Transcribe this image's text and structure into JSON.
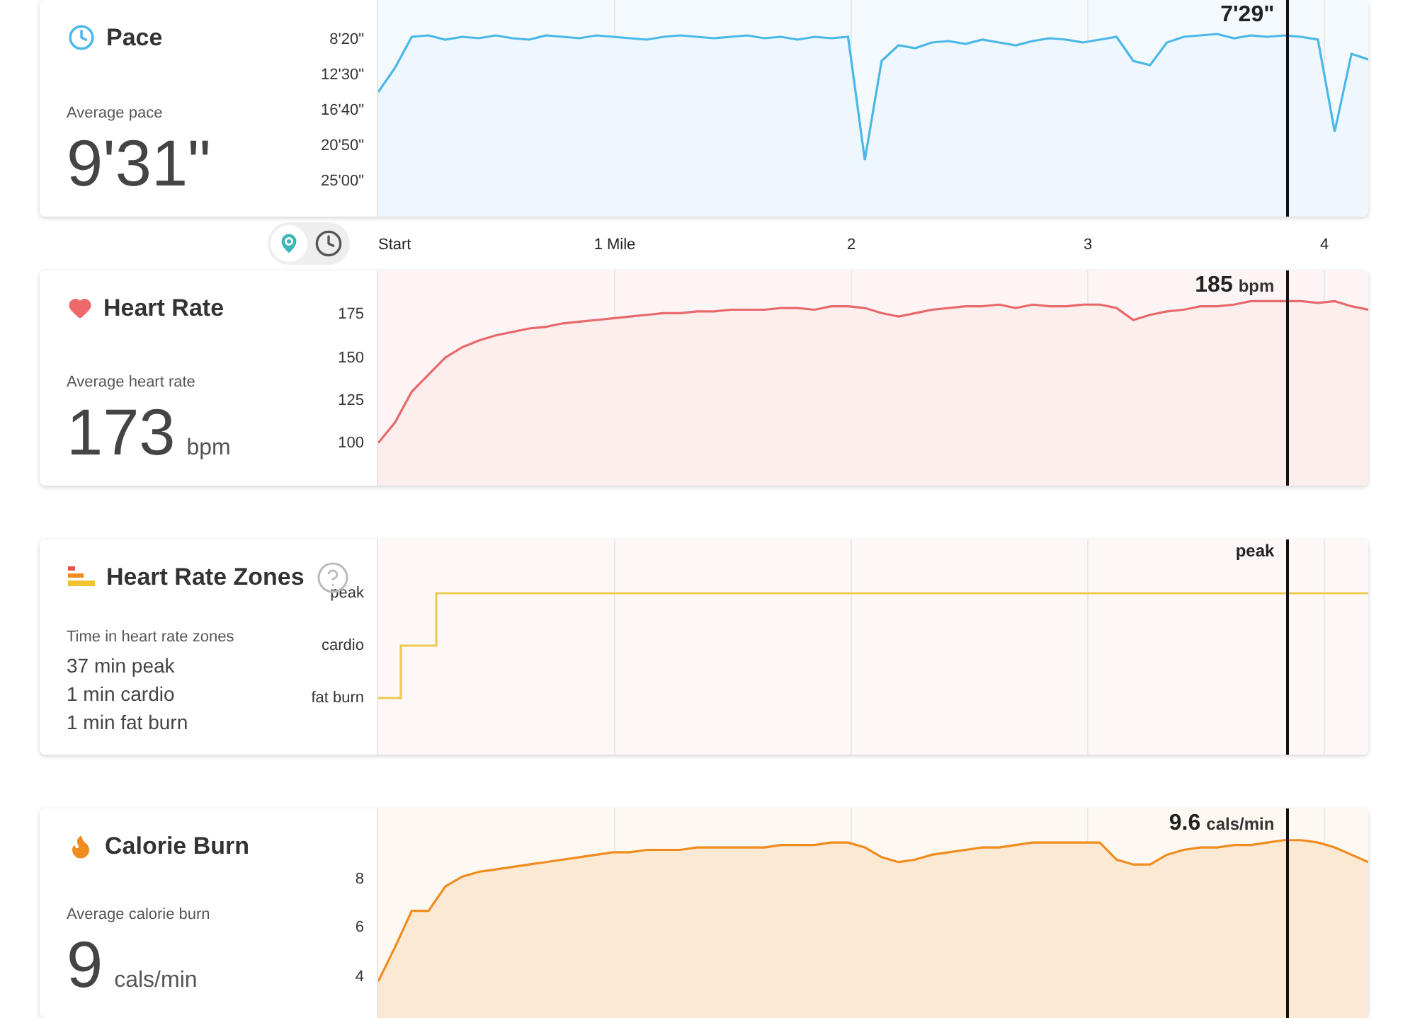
{
  "scrubber": {
    "level": 0.918
  },
  "distance_axis": {
    "labels": [
      "Start",
      "1 Mile",
      "2",
      "3",
      "4"
    ],
    "view_toggle": [
      {
        "kind": "map",
        "selected": true
      },
      {
        "kind": "time",
        "selected": false
      }
    ]
  },
  "cards": [
    {
      "kind": "pace",
      "title": "Pace",
      "help": false,
      "subtitle": "Average pace",
      "value": "9'31\"",
      "readout": {
        "value": "7'29\""
      },
      "y_axis_labels": [
        "8'20\"",
        "12'30\"",
        "16'40\"",
        "20'50\"",
        "25'00\""
      ]
    },
    {
      "kind": "heart",
      "title": "Heart Rate",
      "help": false,
      "subtitle": "Average heart rate",
      "value": "173",
      "unit": "bpm",
      "readout": {
        "value": "185",
        "unit": "bpm"
      },
      "chart_data": {
        "type": "area",
        "ylim": [
          75,
          201
        ],
        "yticks": [
          {
            "value": 175,
            "label": "175"
          },
          {
            "value": 150,
            "label": "150"
          },
          {
            "value": 125,
            "label": "125"
          },
          {
            "value": 100,
            "label": "100"
          }
        ],
        "series": [
          {
            "color": "#e8696b",
            "values": [
              100,
              112,
              130,
              140,
              150,
              156,
              160,
              163,
              165,
              167,
              168,
              170,
              171,
              172,
              173,
              174,
              175,
              176,
              176,
              177,
              177,
              178,
              178,
              178,
              179,
              179,
              178,
              180,
              180,
              179,
              176,
              174,
              176,
              178,
              179,
              180,
              180,
              181,
              179,
              181,
              180,
              180,
              181,
              181,
              179,
              172,
              175,
              177,
              178,
              180,
              180,
              181,
              183,
              183,
              183,
              183,
              182,
              183,
              180,
              178
            ]
          }
        ]
      }
    },
    {
      "kind": "zones",
      "title": "Heart Rate Zones",
      "help": true,
      "subtitle": "Time in heart rate zones",
      "lines": [
        "37 min peak",
        "1 min cardio",
        "1 min fat burn"
      ],
      "readout": {
        "value": "peak"
      },
      "zone_labels": [
        "peak",
        "cardio",
        "fat burn"
      ]
    },
    {
      "kind": "calories",
      "title": "Calorie Burn",
      "help": false,
      "subtitle": "Average calorie burn",
      "value": "9",
      "unit": "cals/min",
      "readout": {
        "value": "9.6",
        "unit": "cals/min"
      },
      "chart_data": {
        "type": "area",
        "ylim": [
          2.3,
          10.9
        ],
        "yticks": [
          {
            "value": 8,
            "label": "8"
          },
          {
            "value": 6,
            "label": "6"
          },
          {
            "value": 4,
            "label": "4"
          }
        ],
        "series": [
          {
            "color": "#f08c1e",
            "values": [
              3.8,
              5.2,
              6.7,
              6.7,
              7.7,
              8.1,
              8.3,
              8.4,
              8.5,
              8.6,
              8.7,
              8.8,
              8.9,
              9.0,
              9.1,
              9.1,
              9.2,
              9.2,
              9.2,
              9.3,
              9.3,
              9.3,
              9.3,
              9.3,
              9.4,
              9.4,
              9.4,
              9.5,
              9.5,
              9.3,
              8.9,
              8.7,
              8.8,
              9.0,
              9.1,
              9.2,
              9.3,
              9.3,
              9.4,
              9.5,
              9.5,
              9.5,
              9.5,
              9.5,
              8.8,
              8.6,
              8.6,
              9.0,
              9.2,
              9.3,
              9.3,
              9.4,
              9.4,
              9.5,
              9.6,
              9.6,
              9.5,
              9.3,
              9.0,
              8.7
            ]
          }
        ]
      }
    }
  ]
}
